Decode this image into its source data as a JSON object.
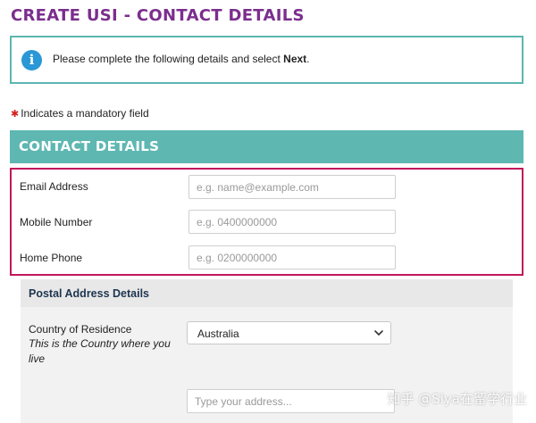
{
  "page_title": "CREATE USI - CONTACT DETAILS",
  "info": {
    "icon": "info-icon",
    "text_before": "Please complete the following details and select ",
    "text_bold": "Next",
    "text_after": "."
  },
  "mandatory_note": "Indicates a mandatory field",
  "contact_section": {
    "title": "CONTACT DETAILS",
    "fields": [
      {
        "label": "Email Address",
        "placeholder": "e.g. name@example.com"
      },
      {
        "label": "Mobile Number",
        "placeholder": "e.g. 0400000000"
      },
      {
        "label": "Home Phone",
        "placeholder": "e.g. 0200000000"
      }
    ]
  },
  "postal_section": {
    "title": "Postal Address Details",
    "country_label": "Country of Residence",
    "country_help": "This is the Country where you live",
    "country_selected": "Australia",
    "address_placeholder": "Type your address..."
  },
  "watermark": "知乎 @Siya在留学行业",
  "colors": {
    "title_purple": "#7b2e8e",
    "teal": "#5fb7b2",
    "info_blue": "#2a97d6",
    "highlight_border": "#c2185b",
    "mandatory_red": "#d61e1e"
  }
}
